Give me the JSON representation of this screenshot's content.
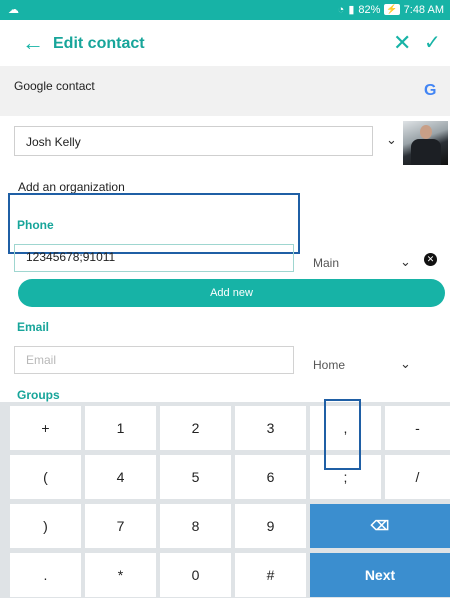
{
  "status": {
    "time": "7:48 AM",
    "battery": "82%"
  },
  "appbar": {
    "title": "Edit contact"
  },
  "account": {
    "label": "Google contact",
    "badge": "G"
  },
  "name": {
    "value": "Josh Kelly"
  },
  "organization": {
    "label": "Add an organization"
  },
  "phone": {
    "section": "Phone",
    "value": "12345678;91011",
    "type": "Main",
    "add_label": "Add new"
  },
  "email": {
    "section": "Email",
    "placeholder": "Email",
    "type": "Home"
  },
  "groups": {
    "section": "Groups"
  },
  "keyboard": {
    "row1": [
      "+",
      "1",
      "2",
      "3",
      ",",
      "-"
    ],
    "row2": [
      "(",
      "4",
      "5",
      "6",
      ";",
      "/"
    ],
    "row3": [
      ")",
      "7",
      "8",
      "9"
    ],
    "row4": [
      ".",
      "*",
      "0",
      "#"
    ],
    "next_label": "Next"
  },
  "colors": {
    "accent": "#17b3a6",
    "action_key": "#3b8ecf",
    "highlight": "#1f5fa5"
  }
}
